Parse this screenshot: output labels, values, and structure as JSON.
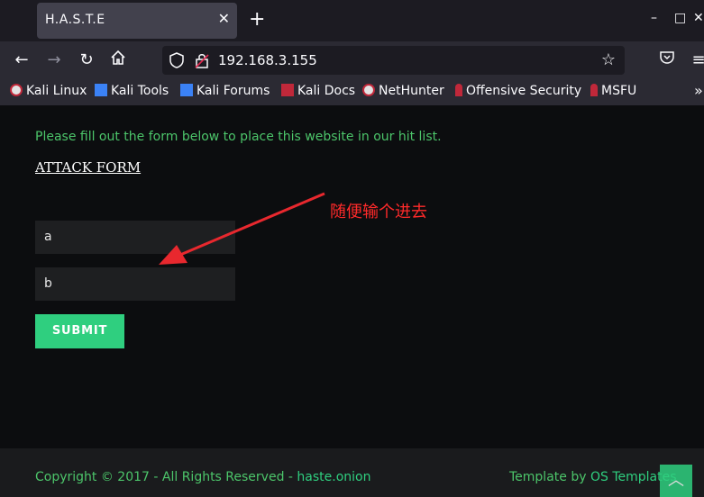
{
  "browser": {
    "tab_title": "H.A.S.T.E",
    "tab_close": "✕",
    "new_tab": "+",
    "window_controls": {
      "minimize": "–",
      "maximize": "□",
      "close": "✕"
    },
    "url": "192.168.3.155",
    "bookmarks": [
      {
        "label": "Kali Linux",
        "icon": "kali-dragon-icon"
      },
      {
        "label": "Kali Tools",
        "icon": "kali-tools-icon"
      },
      {
        "label": "Kali Forums",
        "icon": "kali-forums-icon"
      },
      {
        "label": "Kali Docs",
        "icon": "kali-docs-icon"
      },
      {
        "label": "NetHunter",
        "icon": "nethunter-icon"
      },
      {
        "label": "Offensive Security",
        "icon": "offsec-icon"
      },
      {
        "label": "MSFU",
        "icon": "msfu-icon"
      }
    ],
    "bookmarks_overflow": "»"
  },
  "page": {
    "intro_text": "Please fill out the form below to place this website in our hit list.",
    "form_link": "ATTACK FORM",
    "field1_value": "a",
    "field2_value": "b",
    "submit_label": "SUBMIT",
    "annotation": "随便输个进去"
  },
  "footer": {
    "copyright_prefix": "Copyright © 2017 - All Rights Reserved - ",
    "copyright_link": "haste.onion",
    "template_prefix": "Template by ",
    "template_link": "OS Templates",
    "back_to_top": "︿"
  },
  "colors": {
    "accent_green": "#2fcf7f",
    "text_green": "#4cc56a",
    "annotation_red": "#ff2a2a"
  }
}
